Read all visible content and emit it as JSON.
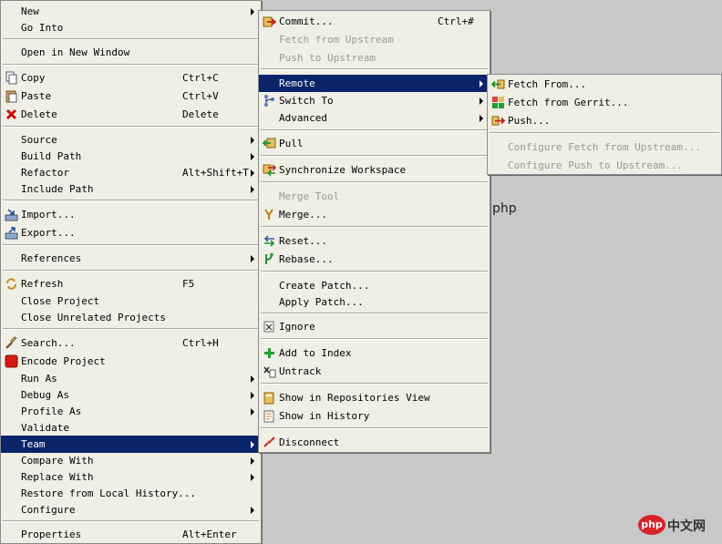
{
  "background_text": "php",
  "watermark": {
    "logo": "php",
    "text": "中文网"
  },
  "main_menu": {
    "new": "New",
    "go_into": "Go Into",
    "open_new_window": "Open in New Window",
    "copy": "Copy",
    "copy_acc": "Ctrl+C",
    "paste": "Paste",
    "paste_acc": "Ctrl+V",
    "delete": "Delete",
    "delete_acc": "Delete",
    "source": "Source",
    "build_path": "Build Path",
    "refactor": "Refactor",
    "refactor_acc": "Alt+Shift+T",
    "include_path": "Include Path",
    "import": "Import...",
    "export": "Export...",
    "references": "References",
    "refresh": "Refresh",
    "refresh_acc": "F5",
    "close_project": "Close Project",
    "close_unrelated": "Close Unrelated Projects",
    "search": "Search...",
    "search_acc": "Ctrl+H",
    "encode_project": "Encode Project",
    "run_as": "Run As",
    "debug_as": "Debug As",
    "profile_as": "Profile As",
    "validate": "Validate",
    "team": "Team",
    "compare_with": "Compare With",
    "replace_with": "Replace With",
    "restore_history": "Restore from Local History...",
    "configure": "Configure",
    "properties": "Properties",
    "properties_acc": "Alt+Enter"
  },
  "team_menu": {
    "commit": "Commit...",
    "commit_acc": "Ctrl+#",
    "fetch_upstream": "Fetch from Upstream",
    "push_upstream": "Push to Upstream",
    "remote": "Remote",
    "switch_to": "Switch To",
    "advanced": "Advanced",
    "pull": "Pull",
    "synchronize": "Synchronize Workspace",
    "merge_tool": "Merge Tool",
    "merge": "Merge...",
    "reset": "Reset...",
    "rebase": "Rebase...",
    "create_patch": "Create Patch...",
    "apply_patch": "Apply Patch...",
    "ignore": "Ignore",
    "add_index": "Add to Index",
    "untrack": "Untrack",
    "show_repos": "Show in Repositories View",
    "show_history": "Show in History",
    "disconnect": "Disconnect"
  },
  "remote_menu": {
    "fetch_from": "Fetch From...",
    "fetch_gerrit": "Fetch from Gerrit...",
    "push": "Push...",
    "configure_fetch": "Configure Fetch from Upstream...",
    "configure_push": "Configure Push to Upstream..."
  },
  "colors": {
    "menu_bg": "#f0efe6",
    "selection": "#0a246a",
    "desktop": "#c8c8c8",
    "disabled": "#9a9a90"
  }
}
